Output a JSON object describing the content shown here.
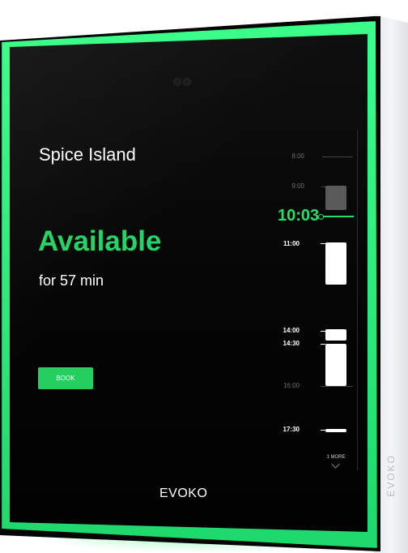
{
  "room": {
    "name": "Spice Island"
  },
  "status": {
    "label": "Available",
    "duration": "for 57 min"
  },
  "actions": {
    "book_label": "BOOK"
  },
  "timeline": {
    "current_time": "10:03",
    "labels": [
      "8:00",
      "9:00",
      "11:00",
      "14:00",
      "14:30",
      "16:00",
      "17:30"
    ],
    "more_label": "1 MORE"
  },
  "brand": {
    "screen_logo": "EVOKO",
    "side_logo": "EVOKO"
  },
  "colors": {
    "accent": "#25d366",
    "background": "#050505",
    "glow": "#3cff8a"
  },
  "icons": {
    "more": "chevron-down-icon"
  }
}
